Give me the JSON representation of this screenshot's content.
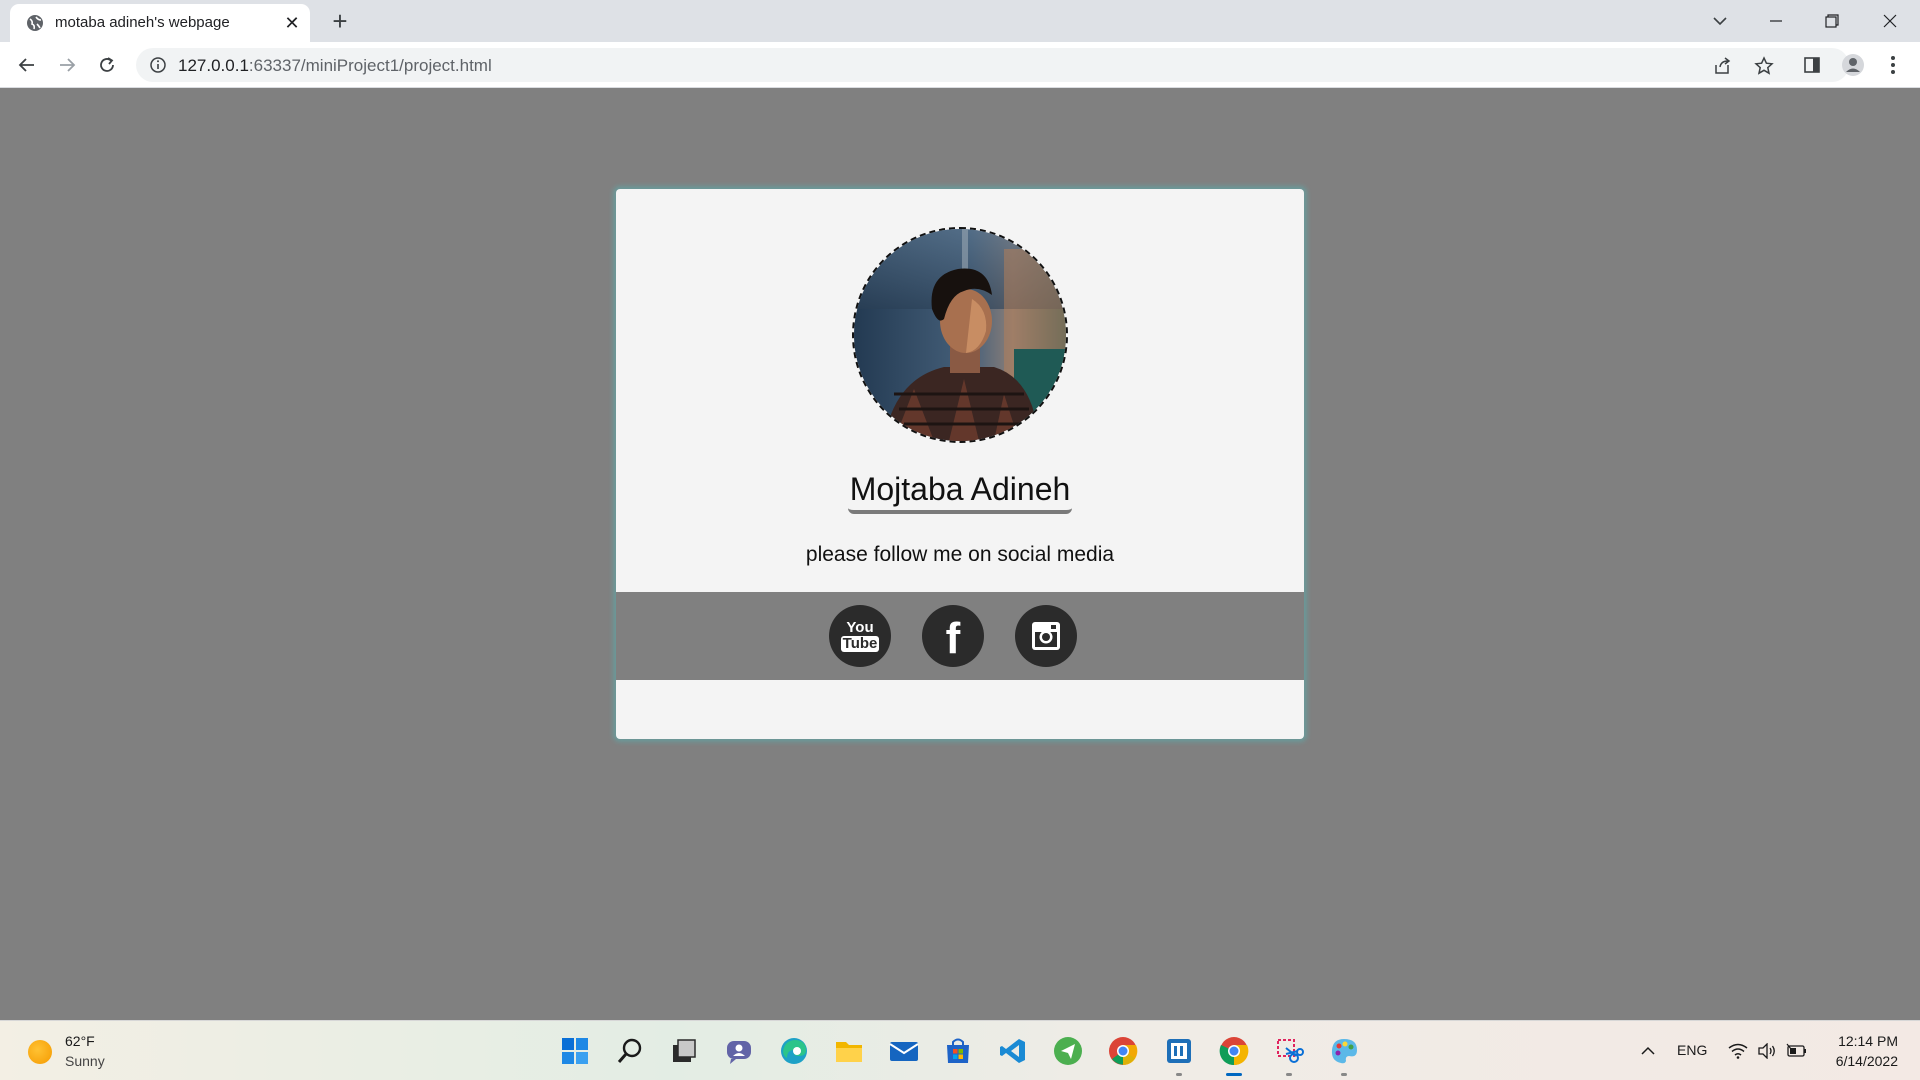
{
  "browser": {
    "tab_title": "motaba adineh's webpage",
    "tab_close": "✕",
    "new_tab": "+",
    "url_host": "127.0.0.1",
    "url_rest": ":63337/miniProject1/project.html"
  },
  "profile": {
    "name": "Mojtaba Adineh",
    "subtitle": "please follow me on social media",
    "youtube_top": "You",
    "youtube_bottom": "Tube",
    "facebook_letter": "f"
  },
  "taskbar": {
    "temperature": "62°F",
    "condition": "Sunny",
    "language": "ENG",
    "time": "12:14 PM",
    "date": "6/14/2022"
  },
  "colors": {
    "page_background": "#808080",
    "card_background": "#f4f4f4",
    "card_glow": "#6a9a9a",
    "social_icon": "#2b2b2b"
  },
  "icons": {
    "social": [
      "youtube-icon",
      "facebook-icon",
      "instagram-icon"
    ],
    "taskbar_apps": [
      "windows-start-icon",
      "search-icon",
      "task-view-icon",
      "chat-icon",
      "edge-icon",
      "file-explorer-icon",
      "mail-icon",
      "store-icon",
      "vscode-icon",
      "send-icon",
      "chrome-icon",
      "terminal-icon",
      "chrome-icon",
      "snipping-tool-icon",
      "paint-icon"
    ]
  }
}
